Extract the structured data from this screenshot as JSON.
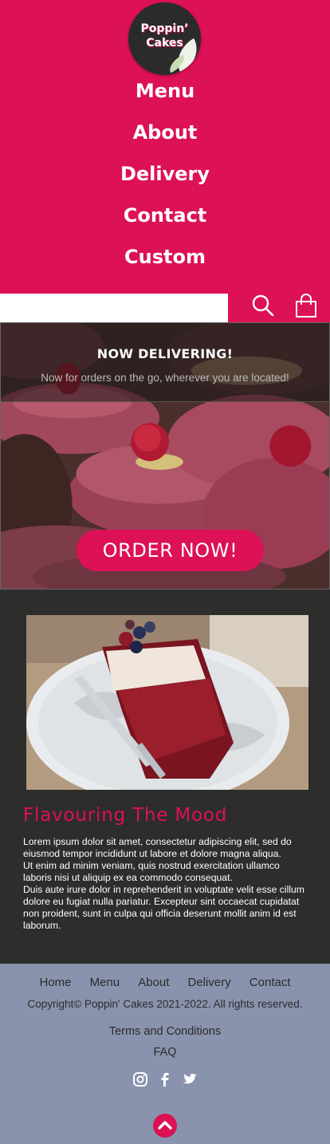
{
  "brand": {
    "logo_line1": "Poppin’",
    "logo_line2": "Cakes"
  },
  "nav": {
    "items": [
      "Menu",
      "About",
      "Delivery",
      "Contact",
      "Custom"
    ]
  },
  "search": {
    "value": "",
    "placeholder": ""
  },
  "banner": {
    "title": "NOW DELIVERING!",
    "subtitle": "Now for orders on the go, wherever you are located!",
    "cta": "ORDER NOW!"
  },
  "feature": {
    "title": "Flavouring The Mood",
    "body": "    Lorem ipsum dolor sit amet, consectetur adipiscing elit, sed do eiusmod tempor incididunt ut labore et dolore magna aliqua.\n Ut enim ad minim veniam, quis nostrud exercitation ullamco laboris nisi ut aliquip ex ea commodo consequat.\nDuis aute irure dolor in reprehenderit in voluptate velit esse cillum dolore eu fugiat nulla pariatur. Excepteur sint occaecat cupidatat non proident, sunt in culpa qui officia deserunt mollit anim id est laborum."
  },
  "footer": {
    "nav": [
      "Home",
      "Menu",
      "About",
      "Delivery",
      "Contact"
    ],
    "copyright": "Copyright© Poppin' Cakes 2021-2022. All rights reserved.",
    "terms": "Terms and Conditions",
    "faq": "FAQ",
    "social": [
      "instagram-icon",
      "facebook-icon",
      "twitter-icon"
    ]
  },
  "colors": {
    "brand": "#dd1155",
    "dark": "#2d2d2b",
    "footer": "#8a93ad"
  }
}
